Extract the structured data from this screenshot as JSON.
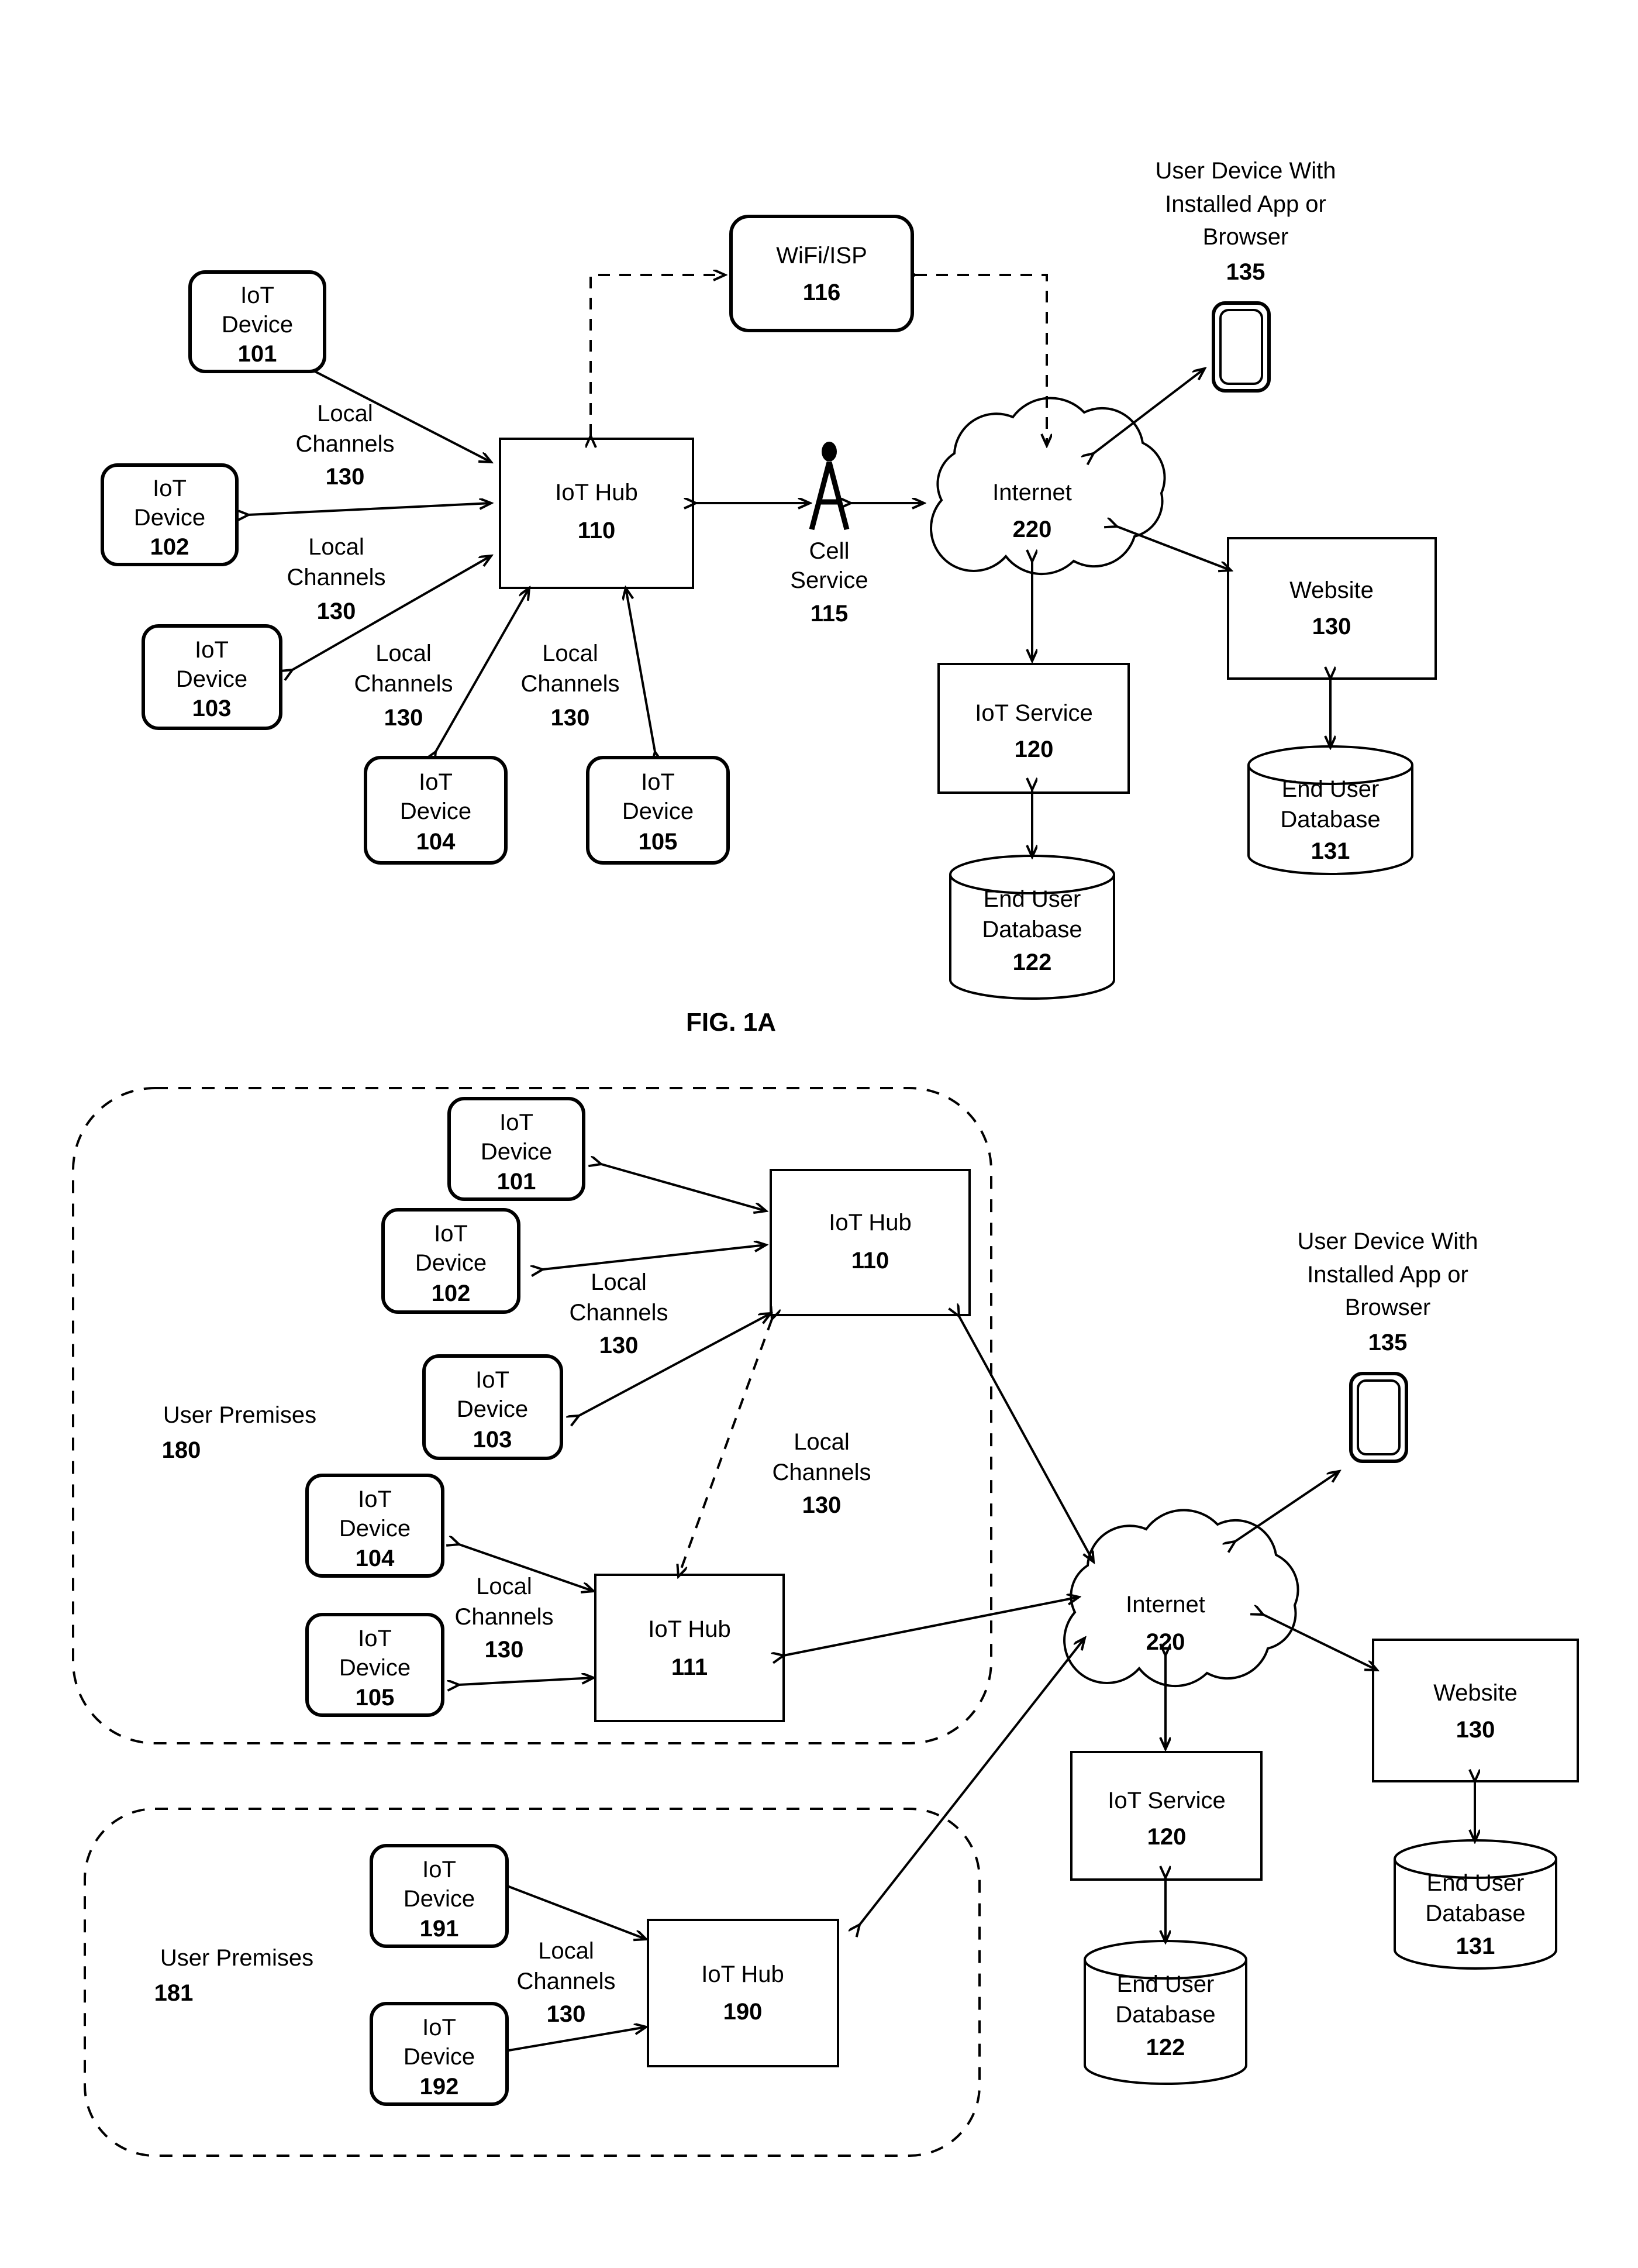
{
  "figures": [
    {
      "id": "fig-top",
      "caption": "FIG. 1A",
      "nodes": {
        "iot_device_101": {
          "line1": "IoT",
          "line2": "Device",
          "num": "101"
        },
        "iot_device_102": {
          "line1": "IoT",
          "line2": "Device",
          "num": "102"
        },
        "iot_device_103": {
          "line1": "IoT",
          "line2": "Device",
          "num": "103"
        },
        "iot_device_104": {
          "line1": "IoT",
          "line2": "Device",
          "num": "104"
        },
        "iot_device_105": {
          "line1": "IoT",
          "line2": "Device",
          "num": "105"
        },
        "iot_hub_110": {
          "line1": "IoT Hub",
          "num": "110"
        },
        "wifi_isp_116": {
          "line1": "WiFi/ISP",
          "num": "116"
        },
        "cell_service_115": {
          "line1": "Cell",
          "line2": "Service",
          "num": "115"
        },
        "internet_220": {
          "line1": "Internet",
          "num": "220"
        },
        "iot_service_120": {
          "line1": "IoT Service",
          "num": "120"
        },
        "end_user_database_122": {
          "line1": "End User",
          "line2": "Database",
          "num": "122"
        },
        "website_130": {
          "line1": "Website",
          "num": "130"
        },
        "end_user_database_131": {
          "line1": "End User",
          "line2": "Database",
          "num": "131"
        },
        "user_device_135": {
          "line1": "User Device With",
          "line2": "Installed App or",
          "line3": "Browser",
          "num": "135"
        }
      },
      "edge_labels": [
        {
          "id": "lc-101",
          "line1": "Local",
          "line2": "Channels",
          "num": "130"
        },
        {
          "id": "lc-102",
          "line1": "Local",
          "line2": "Channels",
          "num": "130"
        },
        {
          "id": "lc-104",
          "line1": "Local",
          "line2": "Channels",
          "num": "130"
        },
        {
          "id": "lc-105",
          "line1": "Local",
          "line2": "Channels",
          "num": "130"
        }
      ]
    },
    {
      "id": "fig-bottom",
      "caption": "",
      "nodes": {
        "iot_device_101": {
          "line1": "IoT",
          "line2": "Device",
          "num": "101"
        },
        "iot_device_102": {
          "line1": "IoT",
          "line2": "Device",
          "num": "102"
        },
        "iot_device_103": {
          "line1": "IoT",
          "line2": "Device",
          "num": "103"
        },
        "iot_device_104": {
          "line1": "IoT",
          "line2": "Device",
          "num": "104"
        },
        "iot_device_105": {
          "line1": "IoT",
          "line2": "Device",
          "num": "105"
        },
        "iot_device_191": {
          "line1": "IoT",
          "line2": "Device",
          "num": "191"
        },
        "iot_device_192": {
          "line1": "IoT",
          "line2": "Device",
          "num": "192"
        },
        "iot_hub_110": {
          "line1": "IoT Hub",
          "num": "110"
        },
        "iot_hub_111": {
          "line1": "IoT Hub",
          "num": "111"
        },
        "iot_hub_190": {
          "line1": "IoT Hub",
          "num": "190"
        },
        "internet_220": {
          "line1": "Internet",
          "num": "220"
        },
        "iot_service_120": {
          "line1": "IoT Service",
          "num": "120"
        },
        "end_user_database_122": {
          "line1": "End User",
          "line2": "Database",
          "num": "122"
        },
        "website_130": {
          "line1": "Website",
          "num": "130"
        },
        "end_user_database_131": {
          "line1": "End User",
          "line2": "Database",
          "num": "131"
        },
        "user_device_135": {
          "line1": "User Device With",
          "line2": "Installed App or",
          "line3": "Browser",
          "num": "135"
        },
        "user_premises_180": {
          "line1": "User Premises",
          "num": "180"
        },
        "user_premises_181": {
          "line1": "User Premises",
          "num": "181"
        }
      },
      "edge_labels": [
        {
          "id": "lc-a",
          "line1": "Local",
          "line2": "Channels",
          "num": "130"
        },
        {
          "id": "lc-b",
          "line1": "Local",
          "line2": "Channels",
          "num": "130"
        },
        {
          "id": "lc-c",
          "line1": "Local",
          "line2": "Channels",
          "num": "130"
        },
        {
          "id": "lc-d",
          "line1": "Local",
          "line2": "Channels",
          "num": "130"
        }
      ]
    }
  ],
  "colors": {
    "stroke": "#000000",
    "background": "#ffffff"
  }
}
